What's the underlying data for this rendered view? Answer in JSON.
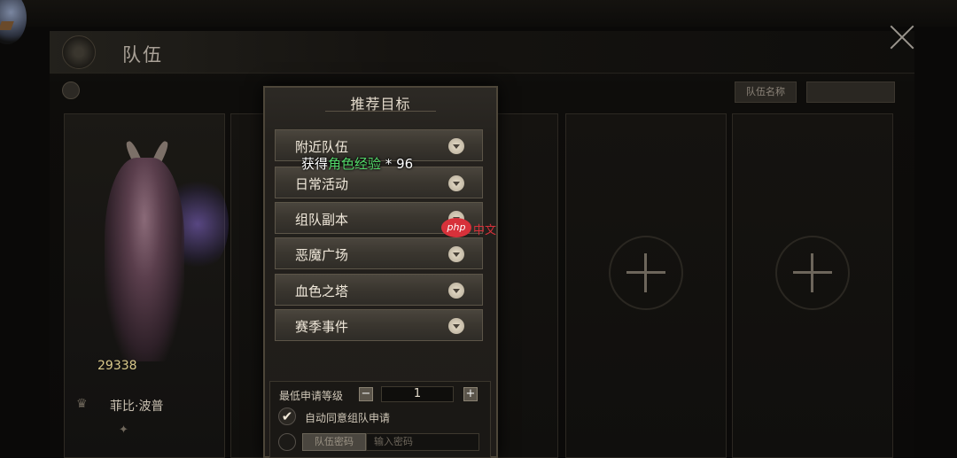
{
  "topbar": {
    "ghost_left": "",
    "ghost_mid": "",
    "ghost_right": ""
  },
  "header": {
    "title": "队伍"
  },
  "subbar": {
    "team_info": "",
    "btn_team_name": "队伍名称",
    "btn_right": ""
  },
  "member": {
    "role": "",
    "power": "29338",
    "name": "菲比·波普",
    "level": ""
  },
  "popup": {
    "title": "推荐目标",
    "dropdowns": [
      {
        "label": "附近队伍"
      },
      {
        "label": "日常活动"
      },
      {
        "label": "组队副本"
      },
      {
        "label": "恶魔广场"
      },
      {
        "label": "血色之塔"
      },
      {
        "label": "赛季事件"
      }
    ],
    "reward": {
      "prefix": "获得",
      "highlight": "角色经验",
      "suffix": " * 96"
    },
    "min_level_label": "最低申请等级",
    "min_level_value": "1",
    "auto_accept_label": "自动同意组队申请",
    "password_button": "队伍密码",
    "password_placeholder": "输入密码"
  },
  "watermark": {
    "badge": "php",
    "text": "中文"
  },
  "colors": {
    "highlight_green": "#53d86a",
    "watermark_red": "#d7313a"
  }
}
